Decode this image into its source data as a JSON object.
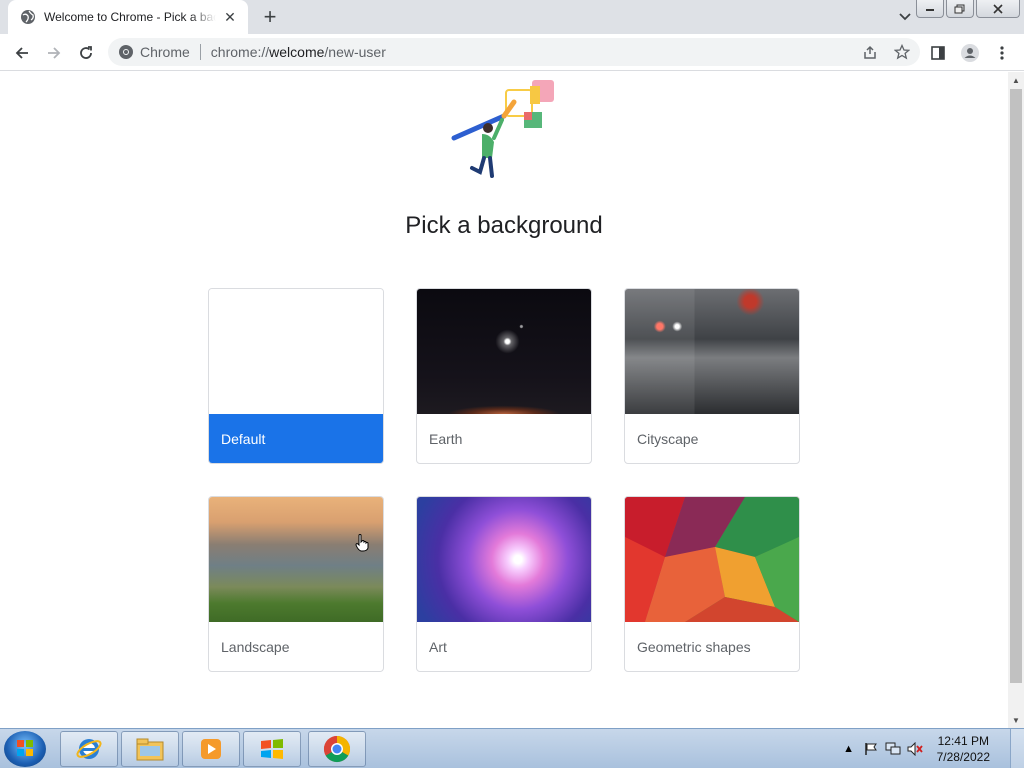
{
  "browser": {
    "tab": {
      "title": "Welcome to Chrome - Pick a background",
      "icon": "globe-icon"
    },
    "omnibox": {
      "site_name": "Chrome",
      "url_prefix": "chrome://",
      "url_host": "welcome",
      "url_path": "/new-user"
    }
  },
  "page": {
    "title": "Pick a background",
    "backgrounds": [
      {
        "label": "Default",
        "selected": true
      },
      {
        "label": "Earth",
        "selected": false
      },
      {
        "label": "Cityscape",
        "selected": false
      },
      {
        "label": "Landscape",
        "selected": false
      },
      {
        "label": "Art",
        "selected": false
      },
      {
        "label": "Geometric shapes",
        "selected": false
      }
    ]
  },
  "taskbar": {
    "apps": [
      "internet-explorer-icon",
      "file-explorer-icon",
      "media-player-icon",
      "windows-icon",
      "chrome-icon"
    ],
    "time": "12:41 PM",
    "date": "7/28/2022"
  },
  "colors": {
    "accent": "#1a73e8",
    "taskbar": "#b8cde4"
  }
}
